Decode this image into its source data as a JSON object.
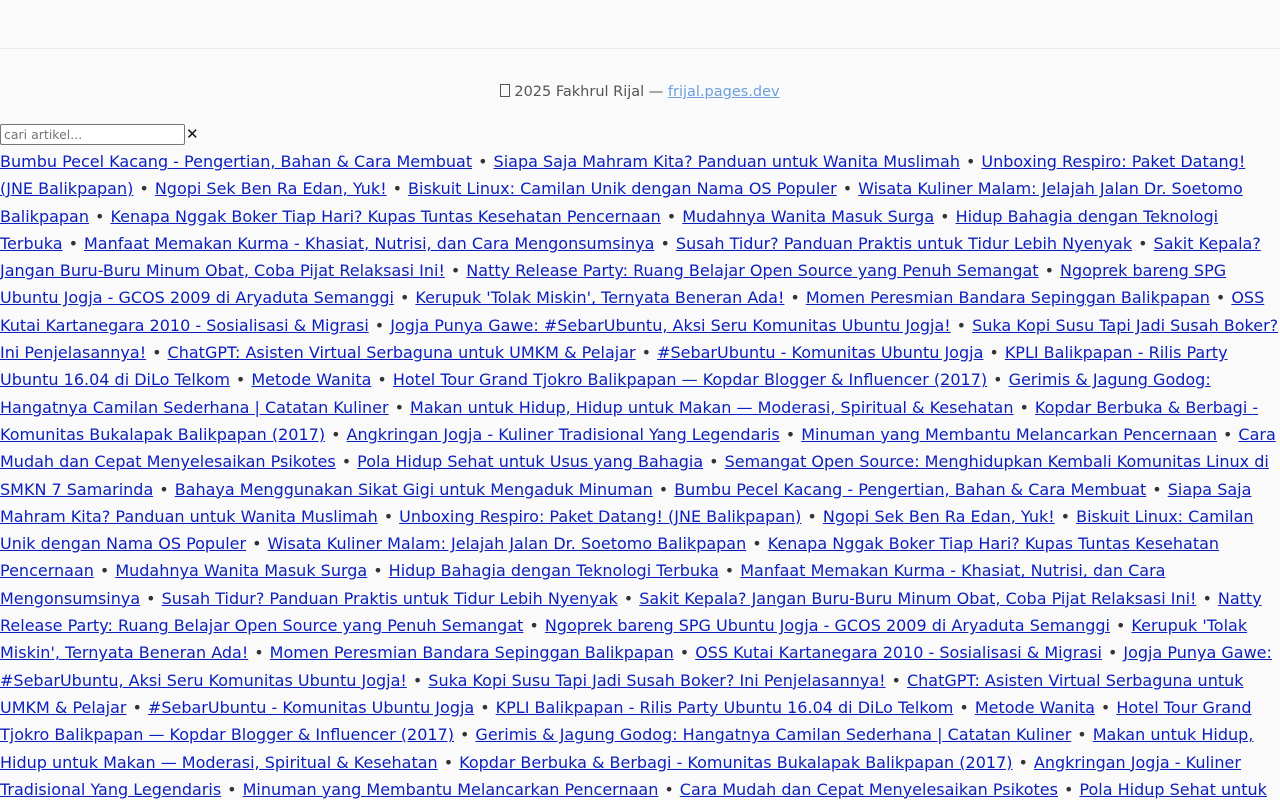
{
  "footer": {
    "copyright_text": "2025 Fakhrul Rijal — ",
    "site_link": "frijal.pages.dev"
  },
  "search": {
    "placeholder": "cari artikel...",
    "value": "",
    "clear_label": "✕"
  },
  "separator": "•",
  "articles": [
    "Bumbu Pecel Kacang - Pengertian, Bahan & Cara Membuat",
    "Siapa Saja Mahram Kita? Panduan untuk Wanita Muslimah",
    "Unboxing Respiro: Paket Datang! (JNE Balikpapan)",
    "Ngopi Sek Ben Ra Edan, Yuk!",
    "Biskuit Linux: Camilan Unik dengan Nama OS Populer",
    "Wisata Kuliner Malam: Jelajah Jalan Dr. Soetomo Balikpapan",
    "Kenapa Nggak Boker Tiap Hari? Kupas Tuntas Kesehatan Pencernaan",
    "Mudahnya Wanita Masuk Surga",
    "Hidup Bahagia dengan Teknologi Terbuka",
    "Manfaat Memakan Kurma - Khasiat, Nutrisi, dan Cara Mengonsumsinya",
    "Susah Tidur? Panduan Praktis untuk Tidur Lebih Nyenyak",
    "Sakit Kepala? Jangan Buru-Buru Minum Obat, Coba Pijat Relaksasi Ini!",
    "Natty Release Party: Ruang Belajar Open Source yang Penuh Semangat",
    "Ngoprek bareng SPG Ubuntu Jogja - GCOS 2009 di Aryaduta Semanggi",
    "Kerupuk 'Tolak Miskin', Ternyata Beneran Ada!",
    "Momen Peresmian Bandara Sepinggan Balikpapan",
    "OSS Kutai Kartanegara 2010 - Sosialisasi & Migrasi",
    "Jogja Punya Gawe: #SebarUbuntu, Aksi Seru Komunitas Ubuntu Jogja!",
    "Suka Kopi Susu Tapi Jadi Susah Boker? Ini Penjelasannya!",
    "ChatGPT: Asisten Virtual Serbaguna untuk UMKM & Pelajar",
    "#SebarUbuntu - Komunitas Ubuntu Jogja",
    "KPLI Balikpapan - Rilis Party Ubuntu 16.04 di DiLo Telkom",
    "Metode Wanita",
    "Hotel Tour Grand Tjokro Balikpapan — Kopdar Blogger & Influencer (2017)",
    "Gerimis & Jagung Godog: Hangatnya Camilan Sederhana | Catatan Kuliner",
    "Makan untuk Hidup, Hidup untuk Makan — Moderasi, Spiritual & Kesehatan",
    "Kopdar Berbuka & Berbagi - Komunitas Bukalapak Balikpapan (2017)",
    "Angkringan Jogja - Kuliner Tradisional Yang Legendaris",
    "Minuman yang Membantu Melancarkan Pencernaan",
    "Cara Mudah dan Cepat Menyelesaikan Psikotes",
    "Pola Hidup Sehat untuk Usus yang Bahagia",
    "Semangat Open Source: Menghidupkan Kembali Komunitas Linux di SMKN 7 Samarinda",
    "Bahaya Menggunakan Sikat Gigi untuk Mengaduk Minuman",
    "Bumbu Pecel Kacang - Pengertian, Bahan & Cara Membuat",
    "Siapa Saja Mahram Kita? Panduan untuk Wanita Muslimah",
    "Unboxing Respiro: Paket Datang! (JNE Balikpapan)",
    "Ngopi Sek Ben Ra Edan, Yuk!",
    "Biskuit Linux: Camilan Unik dengan Nama OS Populer",
    "Wisata Kuliner Malam: Jelajah Jalan Dr. Soetomo Balikpapan",
    "Kenapa Nggak Boker Tiap Hari? Kupas Tuntas Kesehatan Pencernaan",
    "Mudahnya Wanita Masuk Surga",
    "Hidup Bahagia dengan Teknologi Terbuka",
    "Manfaat Memakan Kurma - Khasiat, Nutrisi, dan Cara Mengonsumsinya",
    "Susah Tidur? Panduan Praktis untuk Tidur Lebih Nyenyak",
    "Sakit Kepala? Jangan Buru-Buru Minum Obat, Coba Pijat Relaksasi Ini!",
    "Natty Release Party: Ruang Belajar Open Source yang Penuh Semangat",
    "Ngoprek bareng SPG Ubuntu Jogja - GCOS 2009 di Aryaduta Semanggi",
    "Kerupuk 'Tolak Miskin', Ternyata Beneran Ada!",
    "Momen Peresmian Bandara Sepinggan Balikpapan",
    "OSS Kutai Kartanegara 2010 - Sosialisasi & Migrasi",
    "Jogja Punya Gawe: #SebarUbuntu, Aksi Seru Komunitas Ubuntu Jogja!",
    "Suka Kopi Susu Tapi Jadi Susah Boker? Ini Penjelasannya!",
    "ChatGPT: Asisten Virtual Serbaguna untuk UMKM & Pelajar",
    "#SebarUbuntu - Komunitas Ubuntu Jogja",
    "KPLI Balikpapan - Rilis Party Ubuntu 16.04 di DiLo Telkom",
    "Metode Wanita",
    "Hotel Tour Grand Tjokro Balikpapan — Kopdar Blogger & Influencer (2017)",
    "Gerimis & Jagung Godog: Hangatnya Camilan Sederhana | Catatan Kuliner",
    "Makan untuk Hidup, Hidup untuk Makan — Moderasi, Spiritual & Kesehatan",
    "Kopdar Berbuka & Berbagi - Komunitas Bukalapak Balikpapan (2017)",
    "Angkringan Jogja - Kuliner Tradisional Yang Legendaris",
    "Minuman yang Membantu Melancarkan Pencernaan",
    "Cara Mudah dan Cepat Menyelesaikan Psikotes",
    "Pola Hidup Sehat untuk Usus yang Bahagia"
  ]
}
